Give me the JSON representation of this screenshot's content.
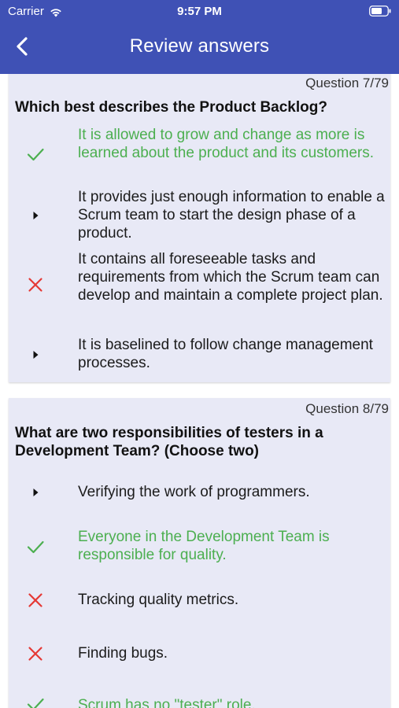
{
  "status_bar": {
    "carrier": "Carrier",
    "time": "9:57 PM"
  },
  "header": {
    "title": "Review answers"
  },
  "colors": {
    "header": "#3f51b5",
    "correct": "#4caf50",
    "wrong": "#e53935",
    "card": "#e8e9f6"
  },
  "questions": [
    {
      "number": "Question 7/79",
      "text": "Which best describes the Product Backlog?",
      "answers": [
        {
          "text": "It is allowed to grow and change as more is learned about the product and its customers.",
          "mark": "check-icon"
        },
        {
          "text": "It provides just enough information to enable a Scrum team to start the design phase of a product.",
          "mark": "triangle-right-icon"
        },
        {
          "text": "It contains all foreseeable tasks and requirements from which the Scrum team can develop and maintain a complete project plan.",
          "mark": "cross-icon"
        },
        {
          "text": "It is baselined to follow change management processes.",
          "mark": "triangle-right-icon"
        }
      ]
    },
    {
      "number": "Question 8/79",
      "text": "What are two responsibilities of testers in a Development Team? (Choose two)",
      "answers": [
        {
          "text": "Verifying the work of programmers.",
          "mark": "triangle-right-icon"
        },
        {
          "text": "Everyone in the Development Team is responsible for quality.",
          "mark": "check-icon"
        },
        {
          "text": "Tracking quality metrics.",
          "mark": "cross-icon"
        },
        {
          "text": "Finding bugs.",
          "mark": "cross-icon"
        },
        {
          "text": "Scrum has no \"tester\" role.",
          "mark": "check-icon"
        }
      ]
    }
  ]
}
